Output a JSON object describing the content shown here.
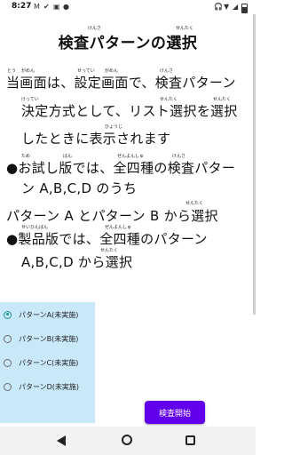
{
  "status_bar": {
    "time": "8:27",
    "icons_left": [
      "M",
      "✔",
      "▣",
      "●"
    ],
    "icons_right": [
      "🎧",
      "▼",
      "◢"
    ]
  },
  "title": {
    "text": "検査パターンの選択",
    "ruby": {
      "kensa": "けんさ",
      "sentaku": "せんたく"
    }
  },
  "paragraph1": {
    "lines": [
      "当画面は、設定画面で、検査パターン",
      "決定方式として、リスト選択を選択",
      "したときに表示されます"
    ],
    "ruby": {
      "tou": "とう",
      "gamen": "がめん",
      "settei": "せってい",
      "gamen2": "がめん",
      "kensa": "けんさ",
      "kettei": "けってい",
      "sentaku1": "せんたく",
      "sentaku2": "せんたく",
      "hyouji": "ひょうじ"
    }
  },
  "paragraph2": {
    "lines": [
      "●お試し版では、全四種の検査パター",
      "ン A,B,C,D のうち",
      "パターン A とパターン B から選択"
    ],
    "ruby": {
      "tame": "ため",
      "ban": "ばん",
      "zenyonshu": "ぜんよんしゅ",
      "kensa": "けんさ",
      "sentaku": "せんたく"
    }
  },
  "paragraph3": {
    "lines": [
      "●製品版では、全四種のパターン",
      "A,B,C,D から選択"
    ],
    "ruby": {
      "seihinban": "せいひんばん",
      "zenyonshu": "ぜんよんしゅ",
      "sentaku": "せんたく"
    }
  },
  "radio_options": [
    {
      "label": "パターンA(未実施)",
      "checked": true
    },
    {
      "label": "パターンB(未実施)",
      "checked": false
    },
    {
      "label": "パターンC(未実施)",
      "checked": false
    },
    {
      "label": "パターンD(未実施)",
      "checked": false
    }
  ],
  "start_button": {
    "label": "検査開始"
  },
  "colors": {
    "accent": "#6200ee",
    "radio_panel": "#c9e9fb",
    "radio_checked": "#1a8f88"
  }
}
